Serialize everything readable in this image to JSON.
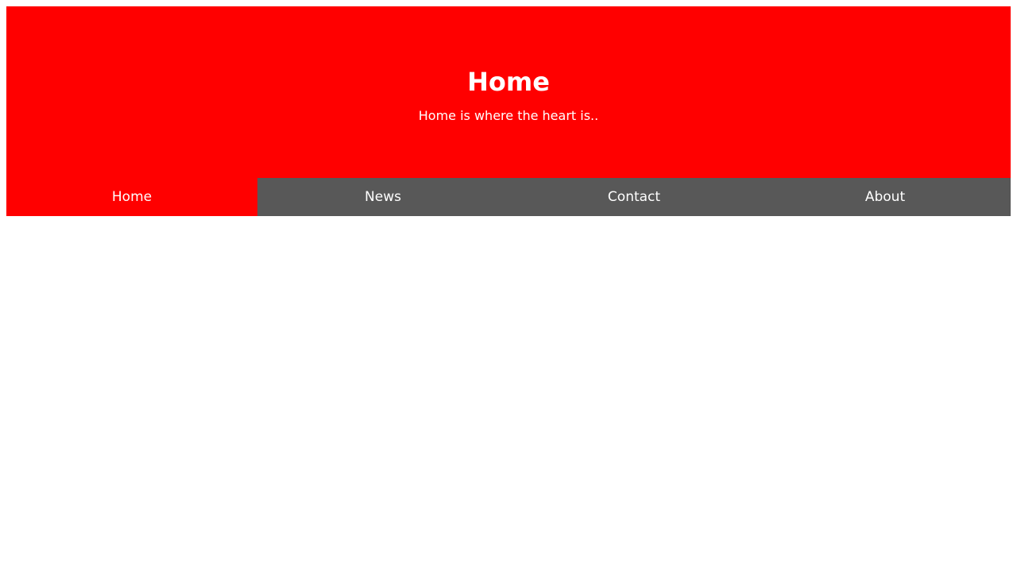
{
  "header": {
    "title": "Home",
    "subtitle": "Home is where the heart is.."
  },
  "tabs": [
    {
      "label": "Home",
      "active": true
    },
    {
      "label": "News",
      "active": false
    },
    {
      "label": "Contact",
      "active": false
    },
    {
      "label": "About",
      "active": false
    }
  ],
  "colors": {
    "accent": "#ff0000",
    "tab_bar": "#585858",
    "text": "#ffffff"
  }
}
